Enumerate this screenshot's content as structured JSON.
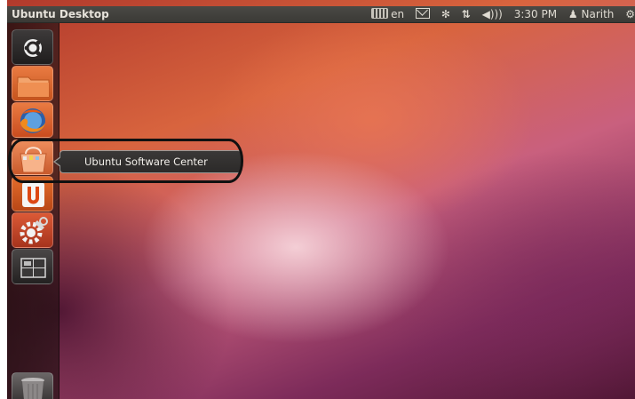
{
  "topbar": {
    "title": "Ubuntu Desktop",
    "keyboard_layout": "en",
    "clock": "3:30 PM",
    "user": "Narith",
    "icons": [
      "keyboard-icon",
      "mail-icon",
      "bluetooth-icon",
      "network-icon",
      "volume-icon",
      "user-icon",
      "gear-icon"
    ]
  },
  "launcher": {
    "items": [
      {
        "name": "dash-home",
        "icon": "ubuntu-logo-icon"
      },
      {
        "name": "home-folder",
        "icon": "folder-icon"
      },
      {
        "name": "firefox",
        "icon": "firefox-icon"
      },
      {
        "name": "ubuntu-software-center",
        "icon": "software-center-icon"
      },
      {
        "name": "ubuntu-one",
        "icon": "ubuntu-one-icon"
      },
      {
        "name": "system-settings",
        "icon": "settings-icon"
      },
      {
        "name": "workspace-switcher",
        "icon": "workspace-icon"
      },
      {
        "name": "trash",
        "icon": "trash-icon"
      }
    ]
  },
  "tooltip": {
    "label": "Ubuntu Software Center"
  },
  "colors": {
    "panel": "#3c3b37",
    "accent": "#dd4814",
    "tooltip_bg": "#333130"
  }
}
